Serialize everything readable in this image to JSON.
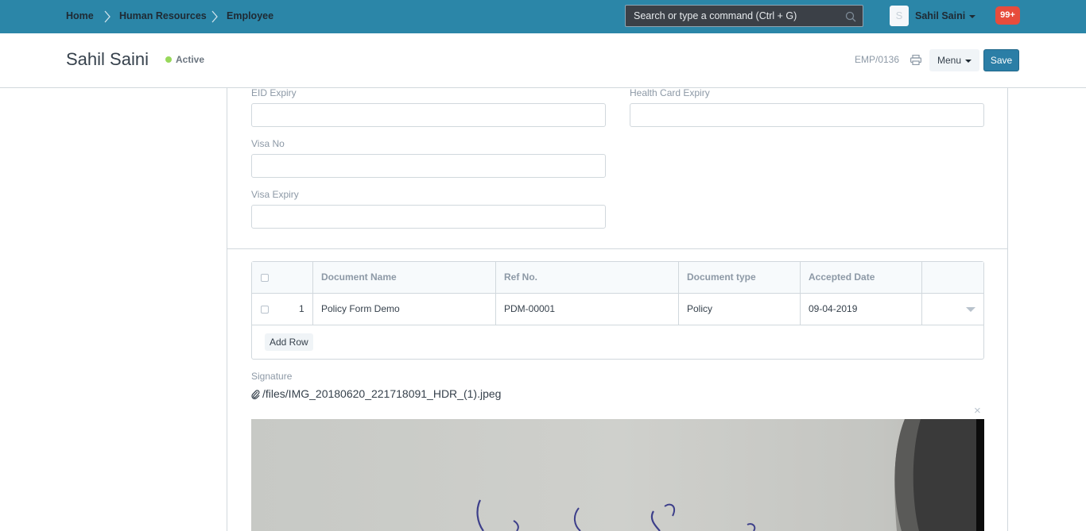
{
  "navbar": {
    "breadcrumbs": [
      "Home",
      "Human Resources",
      "Employee"
    ],
    "search_placeholder": "Search or type a command (Ctrl + G)",
    "avatar_initial": "S",
    "user_name": "Sahil Saini",
    "notification_count": "99+"
  },
  "page": {
    "title": "Sahil Saini",
    "status": "Active",
    "doc_id": "EMP/0136",
    "menu_label": "Menu",
    "save_label": "Save"
  },
  "form": {
    "eid_expiry": {
      "label": "EID Expiry",
      "value": ""
    },
    "health_card_expiry": {
      "label": "Health Card Expiry",
      "value": ""
    },
    "visa_no": {
      "label": "Visa No",
      "value": ""
    },
    "visa_expiry": {
      "label": "Visa Expiry",
      "value": ""
    }
  },
  "documents_table": {
    "columns": [
      "Document Name",
      "Ref No.",
      "Document type",
      "Accepted Date"
    ],
    "rows": [
      {
        "idx": "1",
        "document_name": "Policy Form Demo",
        "ref_no": "PDM-00001",
        "document_type": "Policy",
        "accepted_date": "09-04-2019"
      }
    ],
    "add_row_label": "Add Row"
  },
  "signature": {
    "label": "Signature",
    "file_path": "/files/IMG_20180620_221718091_HDR_(1).jpeg",
    "remove_label": "×"
  },
  "colors": {
    "navbar": "#2b86a8",
    "primary_button": "#2b7ea6",
    "status_dot": "#98d85b",
    "notification": "#e74c3c"
  }
}
